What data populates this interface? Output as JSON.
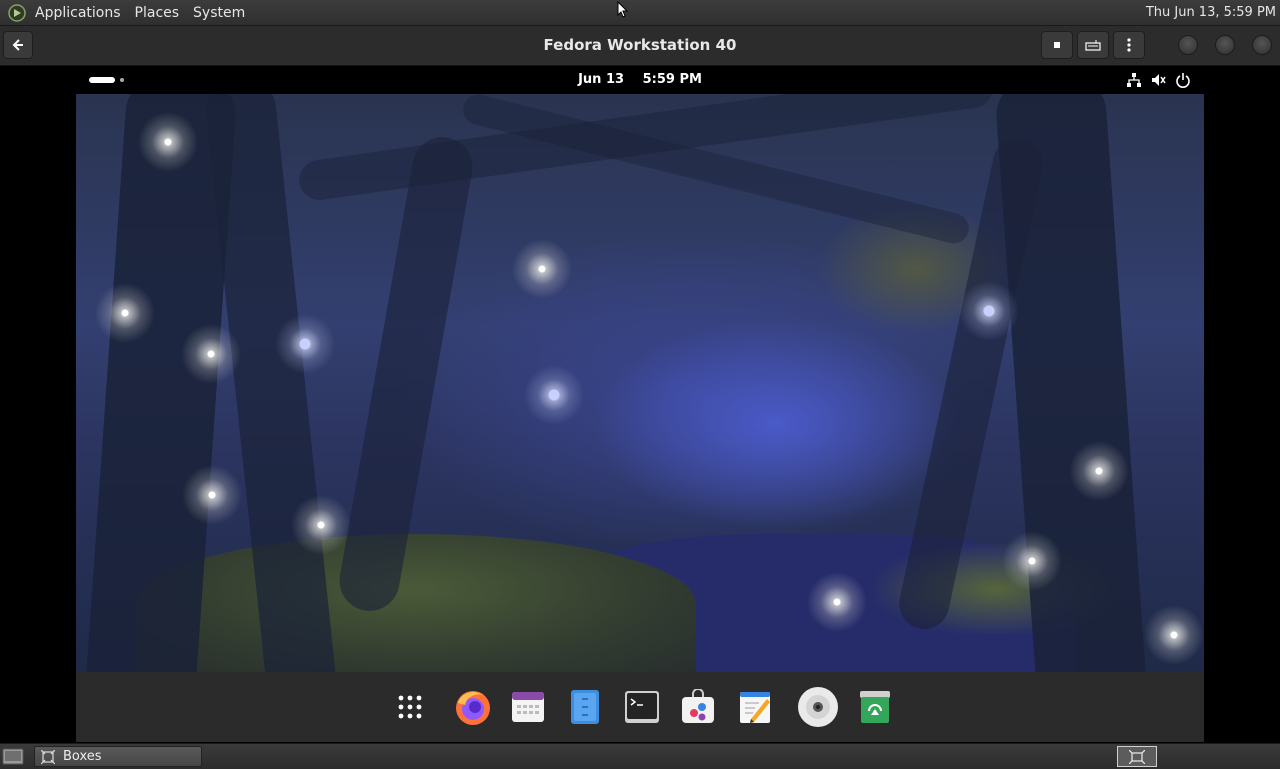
{
  "host_panel": {
    "menus": [
      "Applications",
      "Places",
      "System"
    ],
    "clock": "Thu Jun 13,  5:59 PM"
  },
  "boxes_header": {
    "title": "Fedora Workstation 40",
    "buttons": [
      "back-icon",
      "stop-icon",
      "keyboard-icon",
      "more-options-icon"
    ],
    "window_controls": [
      "minimize",
      "maximize",
      "close"
    ]
  },
  "guest": {
    "date": "Jun 13",
    "time": "5:59 PM",
    "status_icons": [
      "network-icon",
      "volume-muted-icon",
      "power-icon"
    ],
    "wallpaper_theme": "forest-night-fireflies",
    "dock_apps": [
      "show-apps",
      "firefox",
      "calendar",
      "files",
      "terminal",
      "software",
      "text-editor",
      "disk",
      "trash"
    ]
  },
  "taskbar": {
    "window_label": "Boxes"
  },
  "colors": {
    "panel_bg": "#3c3c3c",
    "header_bg": "#2c2c2c",
    "dock_bg": "#2b2b2b",
    "wallpaper_accent": "#4a5ac8"
  }
}
